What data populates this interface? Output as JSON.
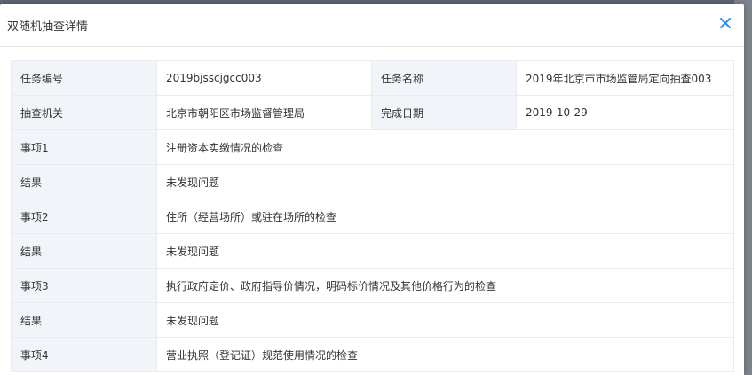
{
  "dialog": {
    "title": "双随机抽查详情",
    "close_icon": "close-icon",
    "colors": {
      "accent": "#2d8cf0",
      "label_bg": "#f1f4f8",
      "border": "#e8ecf1"
    }
  },
  "table": {
    "row1": {
      "task_no_label": "任务编号",
      "task_no_value": "2019bjsscjgcc003",
      "task_name_label": "任务名称",
      "task_name_value": "2019年北京市市场监管局定向抽查003"
    },
    "row2": {
      "agency_label": "抽查机关",
      "agency_value": "北京市朝阳区市场监督管理局",
      "date_label": "完成日期",
      "date_value": "2019-10-29"
    },
    "items": [
      {
        "item_label": "事项1",
        "item_value": "注册资本实缴情况的检查",
        "result_label": "结果",
        "result_value": "未发现问题"
      },
      {
        "item_label": "事项2",
        "item_value": "住所（经营场所）或驻在场所的检查",
        "result_label": "结果",
        "result_value": "未发现问题"
      },
      {
        "item_label": "事项3",
        "item_value": "执行政府定价、政府指导价情况，明码标价情况及其他价格行为的检查",
        "result_label": "结果",
        "result_value": "未发现问题"
      },
      {
        "item_label": "事项4",
        "item_value": "营业执照（登记证）规范使用情况的检查"
      }
    ]
  }
}
